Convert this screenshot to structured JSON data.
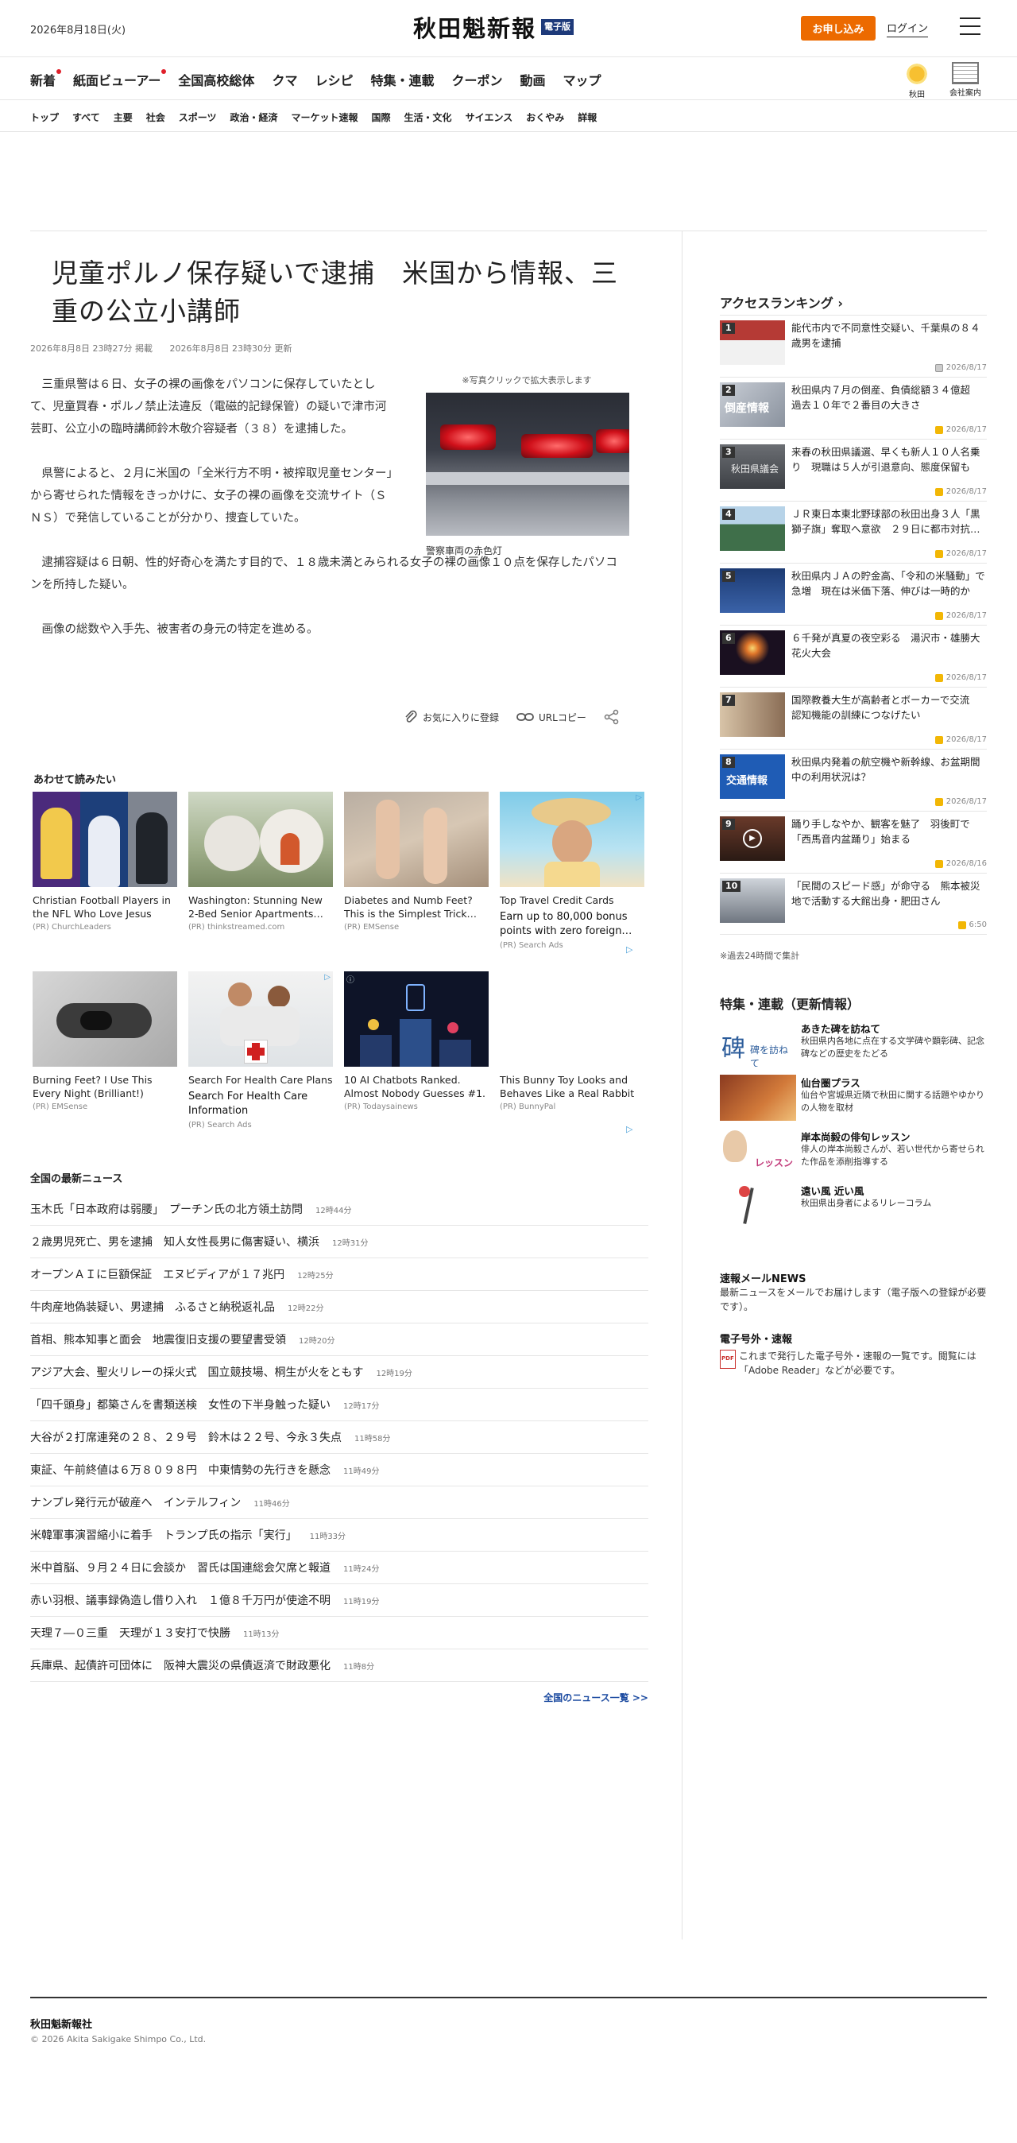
{
  "header": {
    "date": "2026年8月18日(火)",
    "logo_text": "秋田魁新報",
    "logo_tag": "電子版",
    "apply_label": "お申し込み",
    "login_label": "ログイン"
  },
  "main_nav": [
    "新着",
    "紙面ビューアー",
    "全国高校総体",
    "クマ",
    "レシピ",
    "特集・連載",
    "クーポン",
    "動画",
    "マップ"
  ],
  "weather": {
    "label": "秋田",
    "icon": "sun-cloud-icon"
  },
  "company": {
    "label": "会社案内",
    "icon": "building-icon"
  },
  "sub_nav": [
    "トップ",
    "すべて",
    "主要",
    "社会",
    "スポーツ",
    "政治・経済",
    "マーケット速報",
    "国際",
    "生活・文化",
    "サイエンス",
    "おくやみ",
    "詳報"
  ],
  "article": {
    "title": "児童ポルノ保存疑いで逮捕　米国から情報、三重の公立小講師",
    "published": "2026年8月8日 23時27分 掲載",
    "updated": "2026年8月8日 23時30分 更新",
    "paragraphs": [
      "三重県警は６日、女子の裸の画像をパソコンに保存していたとして、児童買春・ポルノ禁止法違反（電磁的記録保管）の疑いで津市河芸町、公立小の臨時講師鈴木敬介容疑者（３８）を逮捕した。",
      "県警によると、２月に米国の「全米行方不明・被搾取児童センター」から寄せられた情報をきっかけに、女子の裸の画像を交流サイト（ＳＮＳ）で発信していることが分かり、捜査していた。",
      "逮捕容疑は６日朝、性的好奇心を満たす目的で、１８歳未満とみられる女子の裸の画像１０点を保存したパソコンを所持した疑い。",
      "画像の総数や入手先、被害者の身元の特定を進める。"
    ],
    "photo_hint": "※写真クリックで拡大表示します",
    "photo_caption": "警察車両の赤色灯",
    "favorite_label": "お気に入りに登録",
    "copy_label": "URLコピー"
  },
  "recommend": {
    "title": "あわせて読みたい",
    "cards": [
      {
        "title": "Christian Football Players in the NFL Who Love Jesus",
        "sub": "",
        "source": "(PR) ChurchLeaders"
      },
      {
        "title": "Washington: Stunning New 2-Bed Senior Apartments…",
        "sub": "",
        "source": "(PR) thinkstreamed.com"
      },
      {
        "title": "Diabetes and Numb Feet? This is the Simplest Trick…",
        "sub": "",
        "source": "(PR) EMSense"
      },
      {
        "title": "Top Travel Credit Cards",
        "sub": "Earn up to 80,000 bonus points with zero foreign…",
        "source": "(PR) Search Ads"
      },
      {
        "title": "Burning Feet? I Use This Every Night (Brilliant!)",
        "sub": "",
        "source": "(PR) EMSense"
      },
      {
        "title": "Search For Health Care Plans",
        "sub": "Search For Health Care Information",
        "source": "(PR) Search Ads"
      },
      {
        "title": "10 AI Chatbots Ranked. Almost Nobody Guesses #1.",
        "sub": "",
        "source": "(PR) Todaysainews"
      },
      {
        "title": "This Bunny Toy Looks and Behaves Like a Real Rabbit",
        "sub": "",
        "source": "(PR) BunnyPal"
      }
    ]
  },
  "latest": {
    "title": "全国の最新ニュース",
    "items": [
      {
        "text": "玉木氏「日本政府は弱腰」　プーチン氏の北方領土訪問",
        "time": "12時44分"
      },
      {
        "text": "２歳男児死亡、男を逮捕　知人女性長男に傷害疑い、横浜",
        "time": "12時31分"
      },
      {
        "text": "オープンＡＩに巨額保証　エヌビディアが１７兆円",
        "time": "12時25分"
      },
      {
        "text": "牛肉産地偽装疑い、男逮捕　ふるさと納税返礼品",
        "time": "12時22分"
      },
      {
        "text": "首相、熊本知事と面会　地震復旧支援の要望書受領",
        "time": "12時20分"
      },
      {
        "text": "アジア大会、聖火リレーの採火式　国立競技場、桐生が火をともす",
        "time": "12時19分"
      },
      {
        "text": "「四千頭身」都築さんを書類送検　女性の下半身触った疑い",
        "time": "12時17分"
      },
      {
        "text": "大谷が２打席連発の２８、２９号　鈴木は２２号、今永３失点",
        "time": "11時58分"
      },
      {
        "text": "東証、午前終値は６万８０９８円　中東情勢の先行きを懸念",
        "time": "11時49分"
      },
      {
        "text": "ナンプレ発行元が破産へ　インテルフィン",
        "time": "11時46分"
      },
      {
        "text": "米韓軍事演習縮小に着手　トランプ氏の指示「実行」",
        "time": "11時33分"
      },
      {
        "text": "米中首脳、９月２４日に会談か　習氏は国連総会欠席と報道",
        "time": "11時24分"
      },
      {
        "text": "赤い羽根、議事録偽造し借り入れ　１億８千万円が使途不明",
        "time": "11時19分"
      },
      {
        "text": "天理７―０三重　天理が１３安打で快勝",
        "time": "11時13分"
      },
      {
        "text": "兵庫県、起債許可団体に　阪神大震災の県債返済で財政悪化",
        "time": "11時8分"
      }
    ],
    "more_label": "全国のニュース一覧 >>"
  },
  "ranking": {
    "title": "アクセスランキング",
    "items": [
      {
        "num": "1",
        "title": "能代市内で不同意性交疑い、千葉県の８４歳男を逮捕",
        "date": "2026/8/17",
        "locked": false
      },
      {
        "num": "2",
        "title": "秋田県内７月の倒産、負債総額３４億超　過去１０年で２番目の大きさ",
        "date": "2026/8/17",
        "locked": true
      },
      {
        "num": "3",
        "title": "来春の秋田県議選、早くも新人１０人名乗り　現職は５人が引退意向、態度保留も",
        "date": "2026/8/17",
        "locked": true
      },
      {
        "num": "4",
        "title": "ＪＲ東日本東北野球部の秋田出身３人「黒獅子旗」奪取へ意欲　２９日に都市対抗…",
        "date": "2026/8/17",
        "locked": true
      },
      {
        "num": "5",
        "title": "秋田県内ＪＡの貯金高、「令和の米騒動」で急増　現在は米価下落、伸びは一時的か",
        "date": "2026/8/17",
        "locked": true
      },
      {
        "num": "6",
        "title": "６千発が真夏の夜空彩る　湯沢市・雄勝大花火大会",
        "date": "2026/8/17",
        "locked": true
      },
      {
        "num": "7",
        "title": "国際教養大生が高齢者とボーカーで交流　認知機能の訓練につなげたい",
        "date": "2026/8/17",
        "locked": true
      },
      {
        "num": "8",
        "title": "秋田県内発着の航空機や新幹線、お盆期間中の利用状況は？",
        "date": "2026/8/17",
        "locked": true
      },
      {
        "num": "9",
        "title": "踊り手しなやか、観客を魅了　羽後町で「西馬音内盆踊り」始まる",
        "date": "2026/8/16",
        "locked": true
      },
      {
        "num": "10",
        "title": "「民間のスピード感」が命守る　熊本被災地で活動する大館出身・肥田さん",
        "date": "6:50",
        "locked": true
      }
    ],
    "note": "※過去24時間で集計"
  },
  "features": {
    "title": "特集・連載（更新情報）",
    "items": [
      {
        "title": "あきた碑を訪ねて",
        "desc": "秋田県内各地に点在する文学碑や顕彰碑、記念碑などの歴史をたどる",
        "thumb_text": "碑を訪ねて"
      },
      {
        "title": "仙台圏プラス",
        "desc": "仙台や宮城県近隣で秋田に関する話題やゆかりの人物を取材",
        "thumb_text": ""
      },
      {
        "title": "岸本尚毅の俳句レッスン",
        "desc": "俳人の岸本尚毅さんが、若い世代から寄せられた作品を添削指導する",
        "thumb_text": "レッスン"
      },
      {
        "title": "遠い風 近い風",
        "desc": "秋田県出身者によるリレーコラム",
        "thumb_text": ""
      }
    ]
  },
  "mail": {
    "title": "速報メールNEWS",
    "desc": "最新ニュースをメールでお届けします（電子版への登録が必要です）。"
  },
  "extra": {
    "title": "電子号外・速報",
    "desc": "これまで発行した電子号外・速報の一覧です。閲覧には「Adobe Reader」などが必要です。"
  },
  "footer": {
    "name": "秋田魁新報社",
    "copyright": "© 2026 Akita Sakigake Shimpo Co., Ltd."
  },
  "colors": {
    "accent": "#ec6a00",
    "link": "#1b4aa0",
    "new_dot": "#e0202a"
  }
}
